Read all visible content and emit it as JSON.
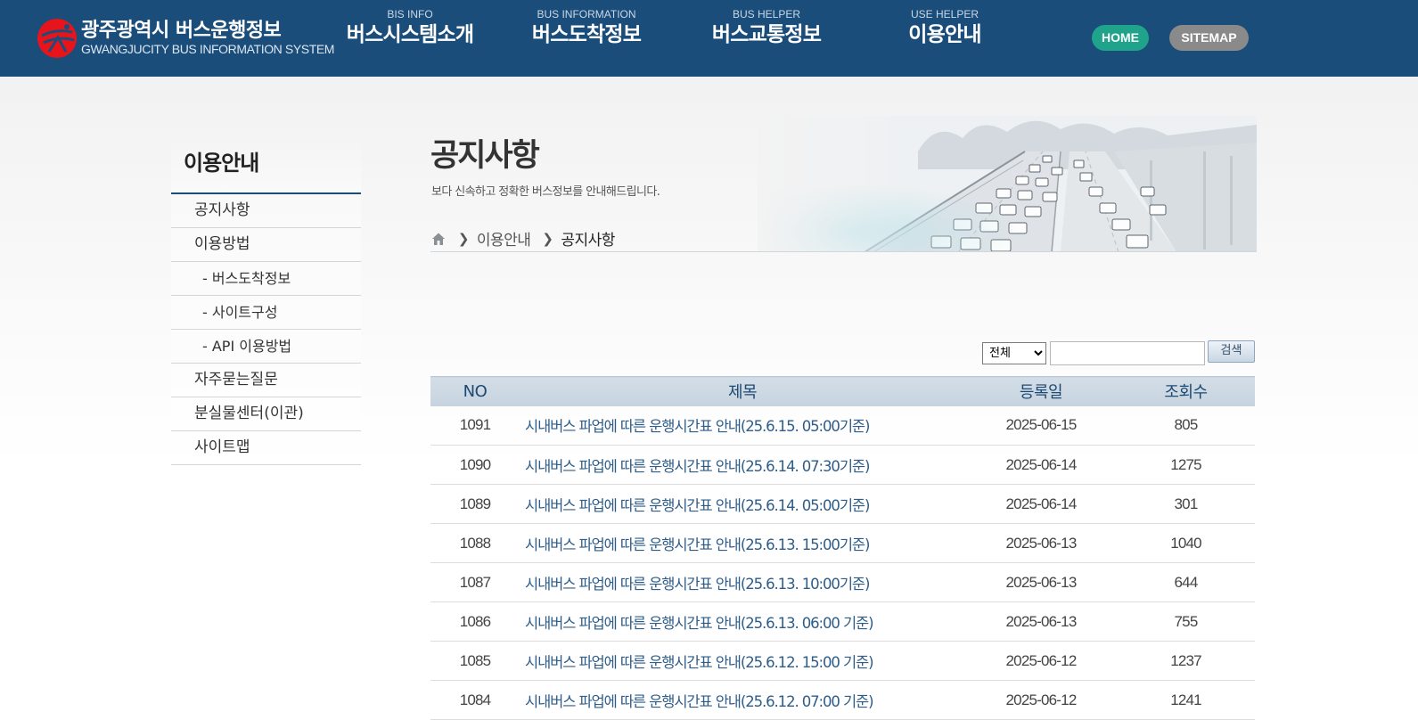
{
  "header": {
    "logo": {
      "title_kr": "광주광역시 버스운행정보",
      "title_en": "GWANGJUCITY BUS INFORMATION SYSTEM"
    },
    "nav": [
      {
        "sub": "BIS INFO",
        "label": "버스시스템소개"
      },
      {
        "sub": "BUS INFORMATION",
        "label": "버스도착정보"
      },
      {
        "sub": "BUS HELPER",
        "label": "버스교통정보"
      },
      {
        "sub": "USE HELPER",
        "label": "이용안내"
      }
    ],
    "home_label": "HOME",
    "sitemap_label": "SITEMAP",
    "colors": {
      "bar": "#1a4d7a",
      "home": "#1fa48b",
      "sitemap": "#8a8a8a",
      "logo_mark": "#e8141c"
    }
  },
  "sidebar": {
    "title": "이용안내",
    "items": [
      {
        "label": "공지사항"
      },
      {
        "label": "이용방법"
      },
      {
        "label": "- 버스도착정보"
      },
      {
        "label": "- 사이트구성"
      },
      {
        "label": "- API 이용방법"
      },
      {
        "label": "자주묻는질문"
      },
      {
        "label": "분실물센터(이관)"
      },
      {
        "label": "사이트맵"
      }
    ]
  },
  "visual": {
    "title": "공지사항",
    "description": "보다 신속하고 정확한  버스정보를 안내해드립니다.",
    "breadcrumb": {
      "home_icon": "home-icon",
      "parent": "이용안내",
      "current": "공지사항"
    }
  },
  "search": {
    "select_value": "전체",
    "input_value": "",
    "button_label": "검색"
  },
  "board": {
    "columns": [
      "NO",
      "제목",
      "등록일",
      "조회수"
    ],
    "rows": [
      {
        "no": "1091",
        "title": "시내버스 파업에 따른 운행시간표 안내(25.6.15. 05:00기준)",
        "date": "2025-06-15",
        "views": "805"
      },
      {
        "no": "1090",
        "title": "시내버스 파업에 따른 운행시간표 안내(25.6.14. 07:30기준)",
        "date": "2025-06-14",
        "views": "1275"
      },
      {
        "no": "1089",
        "title": "시내버스 파업에 따른 운행시간표 안내(25.6.14. 05:00기준)",
        "date": "2025-06-14",
        "views": "301"
      },
      {
        "no": "1088",
        "title": "시내버스 파업에 따른 운행시간표 안내(25.6.13.  15:00기준)",
        "date": "2025-06-13",
        "views": "1040"
      },
      {
        "no": "1087",
        "title": "시내버스 파업에 따른 운행시간표 안내(25.6.13.  10:00기준)",
        "date": "2025-06-13",
        "views": "644"
      },
      {
        "no": "1086",
        "title": "시내버스 파업에 따른 운행시간표 안내(25.6.13. 06:00 기준)",
        "date": "2025-06-13",
        "views": "755"
      },
      {
        "no": "1085",
        "title": "시내버스 파업에 따른 운행시간표 안내(25.6.12.  15:00 기준)",
        "date": "2025-06-12",
        "views": "1237"
      },
      {
        "no": "1084",
        "title": "시내버스 파업에 따른 운행시간표 안내(25.6.12.  07:00 기준)",
        "date": "2025-06-12",
        "views": "1241"
      }
    ]
  }
}
